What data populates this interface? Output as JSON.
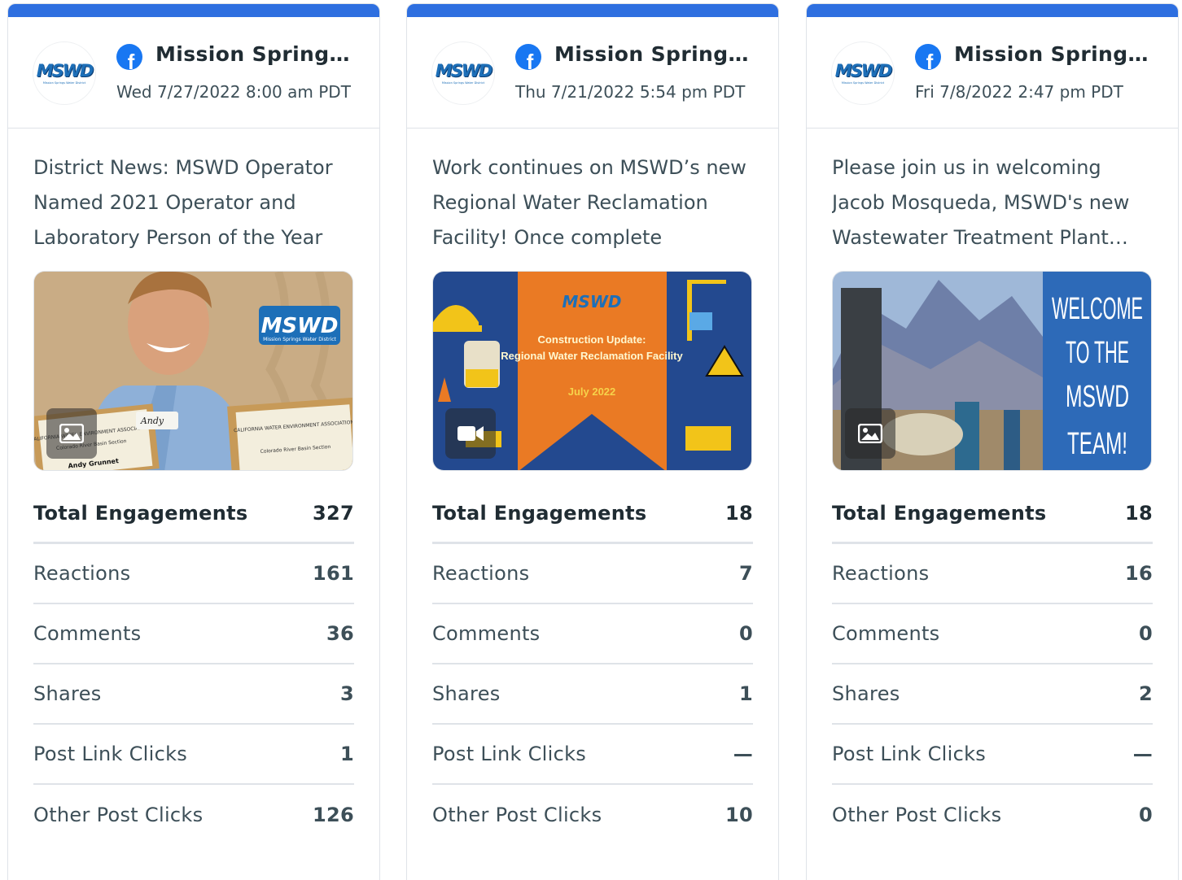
{
  "posts": [
    {
      "page_name": "Mission Springs Water District",
      "date": "Wed 7/27/2022 8:00 am PDT",
      "text": "District News: MSWD Operator Named 2021 Operator and Laboratory Person of the Year",
      "media_type_icon": "image-icon",
      "image_text": {
        "logo": "MSWD",
        "logo_sub": "Mission Springs Water District",
        "badge": "Andy",
        "plaque1": "CALIFORNIA WATER ENVIRONMENT ASSOCIATION",
        "plaque1_sub": "Colorado River Basin Section",
        "plaque1_name": "Andy Grunnet",
        "plaque2": "CALIFORNIA WATER ENVIRONMENT ASSOCIATION",
        "plaque2_sub": "Colorado River Basin Section"
      },
      "total_label": "Total Engagements",
      "total": "327",
      "metrics": [
        {
          "label": "Reactions",
          "value": "161"
        },
        {
          "label": "Comments",
          "value": "36"
        },
        {
          "label": "Shares",
          "value": "3"
        },
        {
          "label": "Post Link Clicks",
          "value": "1"
        },
        {
          "label": "Other Post Clicks",
          "value": "126"
        }
      ]
    },
    {
      "page_name": "Mission Springs Water District",
      "date": "Thu 7/21/2022 5:54 pm PDT",
      "text": "Work continues on MSWD’s new Regional Water Reclamation Facility! Once complete",
      "media_type_icon": "video-icon",
      "image_text": {
        "logo": "MSWD",
        "title": "Construction Update:",
        "subtitle": "Regional Water Reclamation Facility",
        "date": "July 2022"
      },
      "total_label": "Total Engagements",
      "total": "18",
      "metrics": [
        {
          "label": "Reactions",
          "value": "7"
        },
        {
          "label": "Comments",
          "value": "0"
        },
        {
          "label": "Shares",
          "value": "1"
        },
        {
          "label": "Post Link Clicks",
          "value": "—"
        },
        {
          "label": "Other Post Clicks",
          "value": "10"
        }
      ]
    },
    {
      "page_name": "Mission Springs Water District",
      "date": "Fri 7/8/2022 2:47 pm PDT",
      "text": "Please join us in welcoming Jacob Mosqueda, MSWD's new Wastewater Treatment Plant Operator",
      "media_type_icon": "image-icon",
      "image_text": {
        "line1": "WELCOME",
        "line2": "TO THE",
        "line3": "MSWD",
        "line4": "TEAM!"
      },
      "total_label": "Total Engagements",
      "total": "18",
      "metrics": [
        {
          "label": "Reactions",
          "value": "16"
        },
        {
          "label": "Comments",
          "value": "0"
        },
        {
          "label": "Shares",
          "value": "2"
        },
        {
          "label": "Post Link Clicks",
          "value": "—"
        },
        {
          "label": "Other Post Clicks",
          "value": "0"
        }
      ]
    }
  ],
  "logo_text": "MSWD",
  "logo_sub": "Mission Springs Water District",
  "colors": {
    "accent": "#2e6fe0",
    "facebook": "#1877f2",
    "divider": "#dfe3e8",
    "text": "#3d4f58"
  }
}
